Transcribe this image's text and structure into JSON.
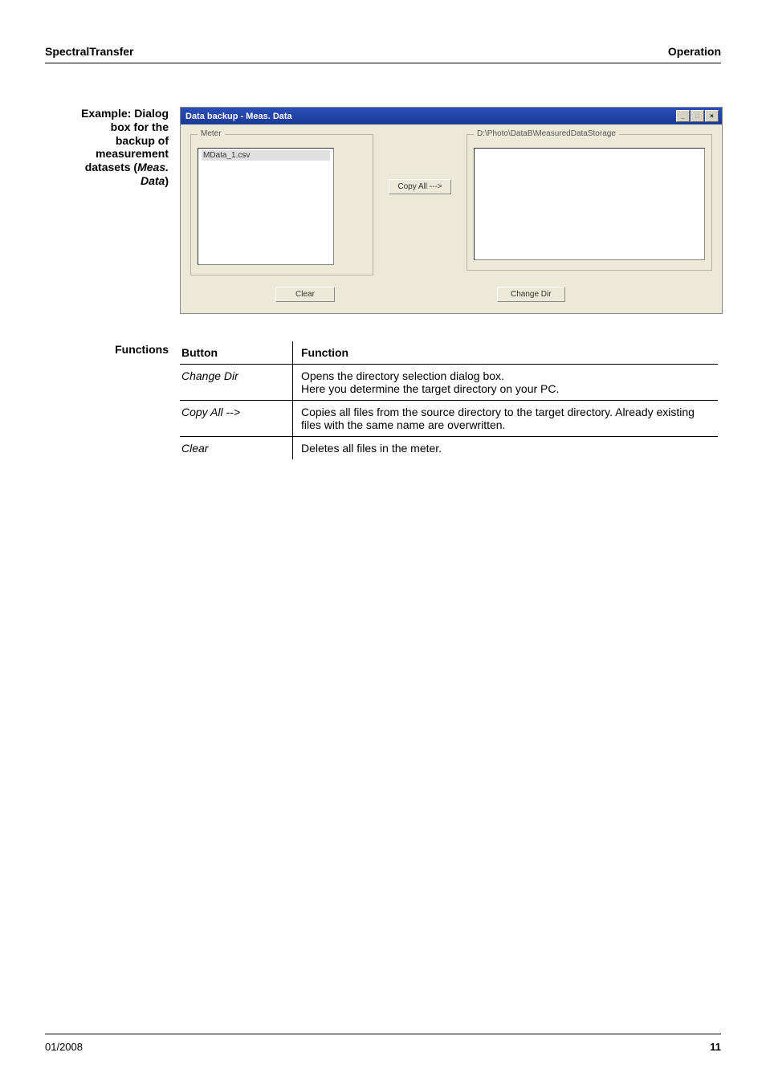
{
  "header": {
    "left": "SpectralTransfer",
    "right": "Operation"
  },
  "sidebar_caption": {
    "line1": "Example: Dialog",
    "line2": "box for the",
    "line3": "backup of",
    "line4": "measurement",
    "line5_prefix": "datasets (",
    "line5_italic": "Meas.",
    "line6_italic": "Data",
    "line6_suffix": ")"
  },
  "dialog": {
    "title": "Data backup - Meas. Data",
    "group_meter": "Meter",
    "meter_file": "MData_1.csv",
    "copy_all_btn": "Copy All --->",
    "target_path": "D:\\Photo\\DataB\\MeasuredDataStorage",
    "clear_btn": "Clear",
    "change_dir_btn": "Change Dir"
  },
  "functions": {
    "label": "Functions",
    "head_button": "Button",
    "head_function": "Function",
    "rows": [
      {
        "button": "Change Dir",
        "desc": "Opens the directory selection dialog box.\nHere you determine the target directory on your PC."
      },
      {
        "button": "Copy All -->",
        "desc": "Copies all files from the source directory to the target directory. Already existing files with the same name are overwritten."
      },
      {
        "button": "Clear",
        "desc": "Deletes all files in the meter."
      }
    ]
  },
  "footer": {
    "date": "01/2008",
    "page": "11"
  }
}
